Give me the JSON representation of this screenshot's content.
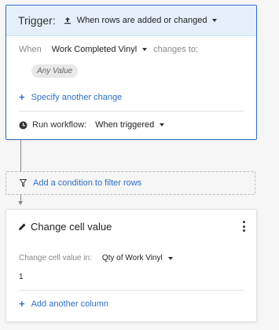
{
  "trigger": {
    "title": "Trigger:",
    "event": "When rows are added or changed",
    "when_label": "When",
    "column": "Work Completed Vinyl",
    "changes_to": "changes to:",
    "any_value": "Any Value",
    "specify_another": "Specify another change",
    "run_label": "Run workflow:",
    "run_value": "When triggered"
  },
  "filter": {
    "label": "Add a condition to filter rows"
  },
  "action": {
    "title": "Change cell value",
    "change_in_label": "Change cell value in:",
    "column": "Qty of Work Vinyl",
    "value": "1",
    "add_column": "Add another column"
  },
  "colors": {
    "accent": "#2f6fc7",
    "header_bg": "#e5f0fc"
  }
}
